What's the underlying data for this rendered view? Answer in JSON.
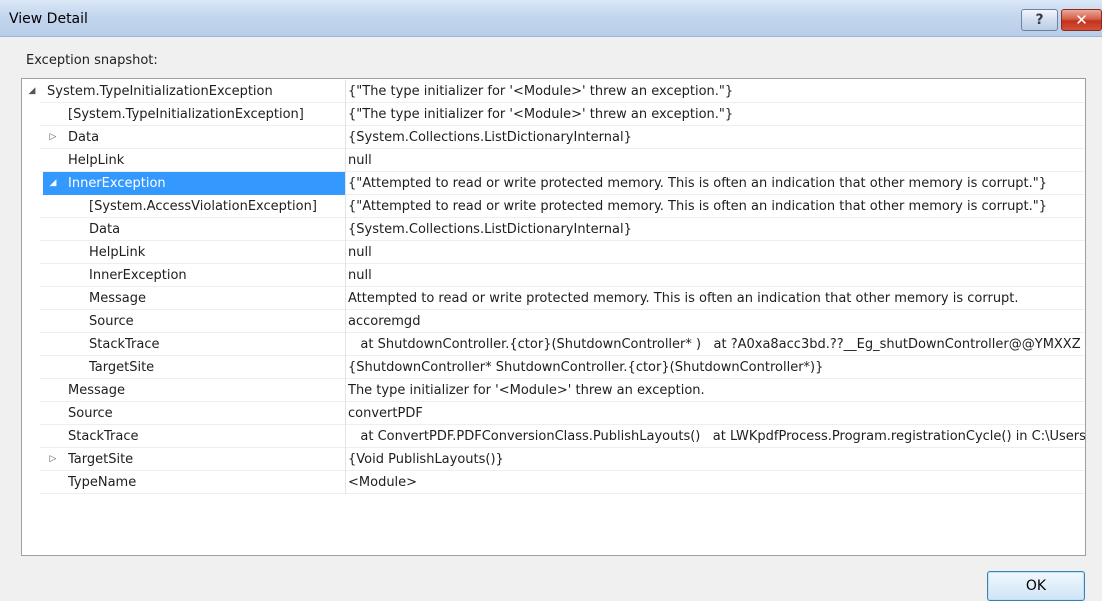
{
  "window": {
    "title": "View Detail",
    "help_label": "?",
    "close_label": "✕"
  },
  "snapshot_label": "Exception snapshot:",
  "rows": [
    {
      "expander": "◢",
      "name": "System.TypeInitializationException",
      "value": "{\"The type initializer for '<Module>' threw an exception.\"}",
      "level": 0,
      "selected": false
    },
    {
      "expander": "",
      "name": "[System.TypeInitializationException]",
      "value": "{\"The type initializer for '<Module>' threw an exception.\"}",
      "level": 1,
      "selected": false
    },
    {
      "expander": "▷",
      "name": "Data",
      "value": "{System.Collections.ListDictionaryInternal}",
      "level": 1,
      "selected": false
    },
    {
      "expander": "",
      "name": "HelpLink",
      "value": "null",
      "level": 1,
      "selected": false
    },
    {
      "expander": "◢",
      "name": "InnerException",
      "value": "{\"Attempted to read or write protected memory. This is often an indication that other memory is corrupt.\"}",
      "level": 1,
      "selected": true
    },
    {
      "expander": "",
      "name": "[System.AccessViolationException]",
      "value": "{\"Attempted to read or write protected memory. This is often an indication that other memory is corrupt.\"}",
      "level": 2,
      "selected": false
    },
    {
      "expander": "",
      "name": "Data",
      "value": "{System.Collections.ListDictionaryInternal}",
      "level": 2,
      "selected": false
    },
    {
      "expander": "",
      "name": "HelpLink",
      "value": "null",
      "level": 2,
      "selected": false
    },
    {
      "expander": "",
      "name": "InnerException",
      "value": "null",
      "level": 2,
      "selected": false
    },
    {
      "expander": "",
      "name": "Message",
      "value": "Attempted to read or write protected memory. This is often an indication that other memory is corrupt.",
      "level": 2,
      "selected": false
    },
    {
      "expander": "",
      "name": "Source",
      "value": "accoremgd",
      "level": 2,
      "selected": false
    },
    {
      "expander": "",
      "name": "StackTrace",
      "value": "   at ShutdownController.{ctor}(ShutdownController* )   at ?A0xa8acc3bd.??__Eg_shutDownController@@YMXXZ",
      "level": 2,
      "selected": false
    },
    {
      "expander": "",
      "name": "TargetSite",
      "value": "{ShutdownController* ShutdownController.{ctor}(ShutdownController*)}",
      "level": 2,
      "selected": false
    },
    {
      "expander": "",
      "name": "Message",
      "value": "The type initializer for '<Module>' threw an exception.",
      "level": 1,
      "selected": false
    },
    {
      "expander": "",
      "name": "Source",
      "value": "convertPDF",
      "level": 1,
      "selected": false
    },
    {
      "expander": "",
      "name": "StackTrace",
      "value": "   at ConvertPDF.PDFConversionClass.PublishLayouts()   at LWKpdfProcess.Program.registrationCycle() in C:\\Users",
      "level": 1,
      "selected": false
    },
    {
      "expander": "▷",
      "name": "TargetSite",
      "value": "{Void PublishLayouts()}",
      "level": 1,
      "selected": false
    },
    {
      "expander": "",
      "name": "TypeName",
      "value": "<Module>",
      "level": 1,
      "selected": false
    }
  ],
  "ok_label": "OK"
}
